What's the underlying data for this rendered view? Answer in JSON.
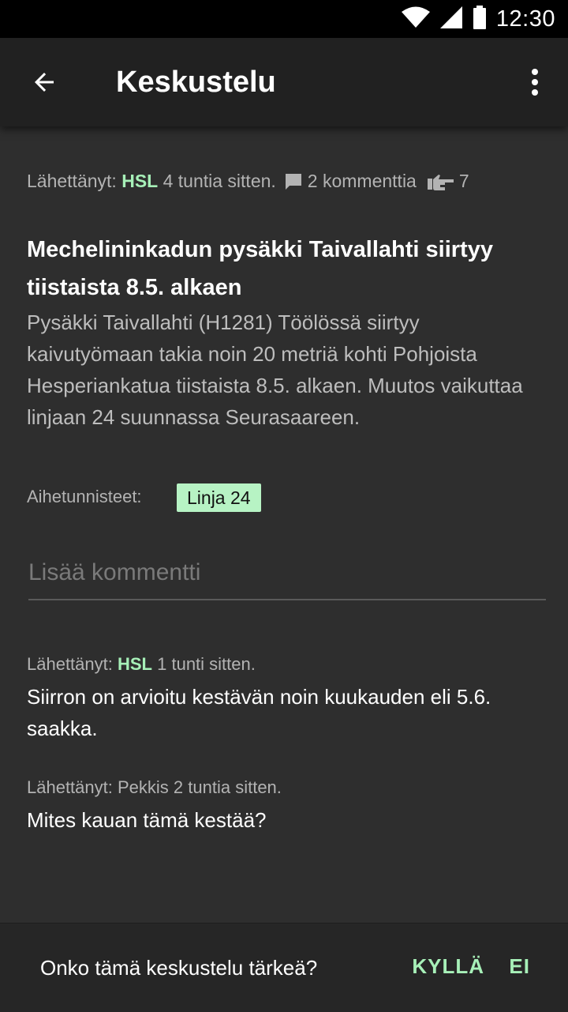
{
  "status_bar": {
    "time": "12:30",
    "icons": [
      "wifi-icon",
      "signal-icon",
      "battery-icon"
    ]
  },
  "app_bar": {
    "title": "Keskustelu",
    "back_icon": "arrow-back-icon",
    "menu_icon": "more-vert-icon"
  },
  "post": {
    "meta": {
      "posted_by_label": "Lähettänyt:",
      "author": "HSL",
      "time_ago": "4 tuntia sitten.",
      "comments_count": "2 kommenttia",
      "likes_count": "7"
    },
    "title": "Mechelininkadun pysäkki Taivallahti siirtyy tiistaista 8.5. alkaen",
    "body": "Pysäkki Taivallahti (H1281) Töölössä siirtyy kaivutyömaan takia noin 20 metriä kohti Pohjoista Hesperiankatua tiistaista 8.5. alkaen. Muutos vaikuttaa linjaan 24 suunnassa Seurasaareen.",
    "tags_label": "Aihetunnisteet:",
    "tags": [
      "Linja 24"
    ]
  },
  "comment_input": {
    "placeholder": "Lisää kommentti"
  },
  "comments": [
    {
      "posted_by_label": "Lähettänyt:",
      "author": "HSL",
      "time_ago": "1 tunti sitten.",
      "text": "Siirron on arvioitu kestävän noin kuukauden eli 5.6. saakka."
    },
    {
      "posted_by_label": "Lähettänyt:",
      "author": "Pekkis",
      "time_ago": "2 tuntia sitten.",
      "text": "Mites kauan tämä kestää?"
    }
  ],
  "bottom_bar": {
    "question": "Onko tämä keskustelu tärkeä?",
    "yes_label": "KYLLÄ",
    "no_label": "EI"
  },
  "colors": {
    "accent": "#a7f0b8",
    "tag_background": "#b7f3c4",
    "background": "#2e2e2e",
    "app_bar": "#212121",
    "status_bar": "#000000"
  }
}
